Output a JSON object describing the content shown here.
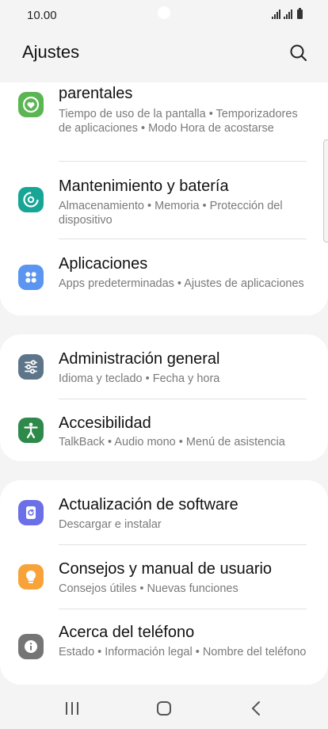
{
  "status_bar": {
    "time": "10.00"
  },
  "header": {
    "title": "Ajustes"
  },
  "cards": [
    {
      "items": [
        {
          "title": "parentales",
          "subtitle": "Tiempo de uso de la pantalla  •  Temporizadores de aplicaciones  •  Modo Hora de acostarse",
          "icon": "digital-wellbeing-icon",
          "color": "#5ab552"
        },
        {
          "title": "Mantenimiento y batería",
          "subtitle": "Almacenamiento  •  Memoria  •  Protección del dispositivo",
          "icon": "device-care-icon",
          "color": "#17a596"
        },
        {
          "title": "Aplicaciones",
          "subtitle": "Apps predeterminadas  •  Ajustes de aplicaciones",
          "icon": "apps-icon",
          "color": "#5b95f0"
        }
      ]
    },
    {
      "items": [
        {
          "title": "Administración general",
          "subtitle": "Idioma y teclado  •  Fecha y hora",
          "icon": "sliders-icon",
          "color": "#5d7489"
        },
        {
          "title": "Accesibilidad",
          "subtitle": "TalkBack  •  Audio mono  •  Menú de asistencia",
          "icon": "accessibility-icon",
          "color": "#2e8a4a"
        }
      ]
    },
    {
      "items": [
        {
          "title": "Actualización de software",
          "subtitle": "Descargar e instalar",
          "icon": "software-update-icon",
          "color": "#6b6fe8"
        },
        {
          "title": "Consejos y manual de usuario",
          "subtitle": "Consejos útiles  •  Nuevas funciones",
          "icon": "lightbulb-icon",
          "color": "#f8a33a"
        },
        {
          "title": "Acerca del teléfono",
          "subtitle": "Estado  •  Información legal  •  Nombre del teléfono",
          "icon": "info-icon",
          "color": "#757575"
        }
      ]
    }
  ],
  "nav_bar": {
    "buttons": [
      "recents-icon",
      "home-icon",
      "back-icon"
    ]
  }
}
